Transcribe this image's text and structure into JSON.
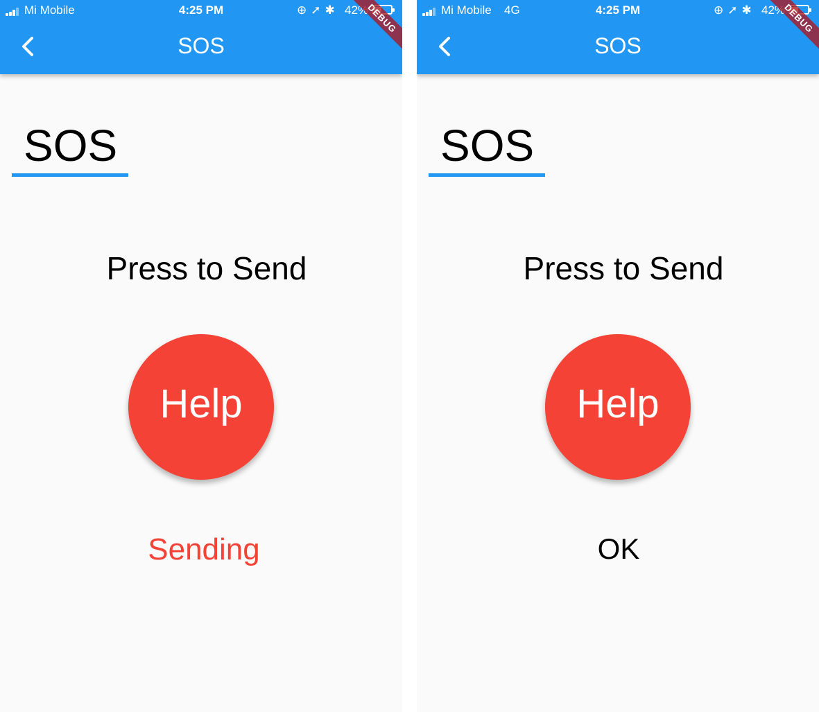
{
  "screens": [
    {
      "statusbar": {
        "carrier": "Mi Mobile",
        "network": "",
        "time": "4:25 PM",
        "battery": "42%"
      },
      "appbar": {
        "title": "SOS"
      },
      "debug_banner": "DEBUG",
      "heading": "SOS",
      "prompt": "Press to Send",
      "help_button": "Help",
      "status": "Sending"
    },
    {
      "statusbar": {
        "carrier": "Mi Mobile",
        "network": "4G",
        "time": "4:25 PM",
        "battery": "42%"
      },
      "appbar": {
        "title": "SOS"
      },
      "debug_banner": "DEBUG",
      "heading": "SOS",
      "prompt": "Press to Send",
      "help_button": "Help",
      "status": "OK"
    }
  ],
  "colors": {
    "primary": "#2196f3",
    "accent_red": "#f44336",
    "background": "#fafafa"
  },
  "battery_level": 0.42
}
